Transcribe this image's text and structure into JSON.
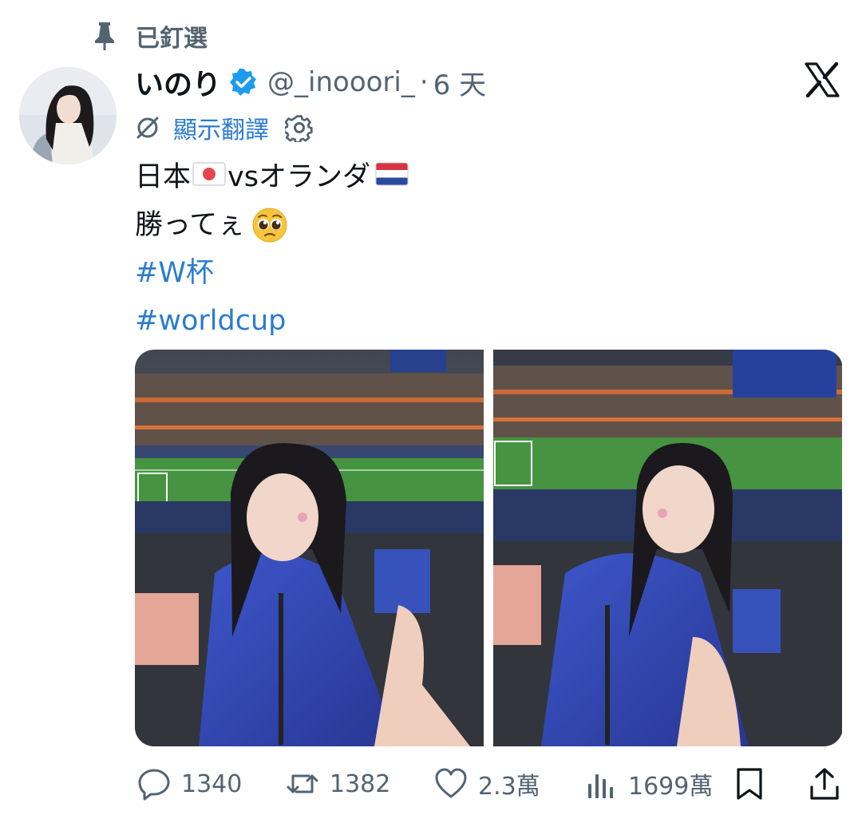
{
  "pinned": {
    "label": "已釘選",
    "icon": "pin-icon"
  },
  "author": {
    "display_name": "いのり",
    "handle": "@_inooori_",
    "separator": "·",
    "time": "6 天",
    "verified_icon": "verified-badge-icon",
    "avatar": "avatar"
  },
  "translate": {
    "label": "顯示翻譯",
    "icons": [
      "globe-slash-icon",
      "gear-icon"
    ]
  },
  "brand": {
    "logo": "x-logo"
  },
  "tweet": {
    "line1_a": "日本",
    "line1_b": "vsオランダ",
    "line2": "勝ってぇ",
    "hashtag1": "#W杯",
    "hashtag2": "#worldcup"
  },
  "media": {
    "count": 2,
    "photos": [
      "stadium-selfie-1",
      "stadium-selfie-2"
    ]
  },
  "actions": {
    "reply_count": "1340",
    "repost_count": "1382",
    "like_count": "2.3萬",
    "views_count": "1699萬"
  },
  "colors": {
    "link": "#2b7bd0",
    "muted": "#536471",
    "verified": "#1d9bf0",
    "text": "#0f1419"
  }
}
